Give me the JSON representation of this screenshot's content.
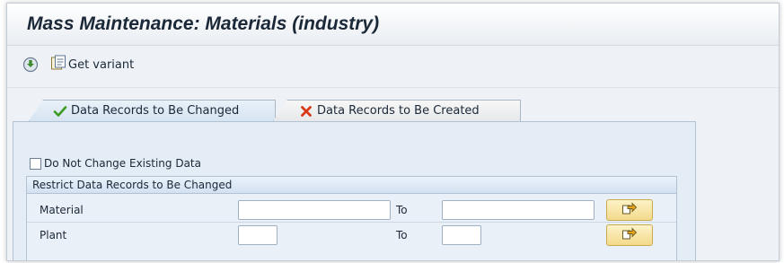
{
  "window": {
    "title": "Mass Maintenance: Materials (industry)"
  },
  "toolbar": {
    "execute_icon": "execute-icon",
    "get_variant_icon": "get-variant-icon",
    "get_variant_label": "Get variant"
  },
  "tabs": [
    {
      "label": "Data Records to Be Changed",
      "icon": "green-checkmark-icon",
      "active": true
    },
    {
      "label": "Data Records to Be Created",
      "icon": "red-x-icon",
      "active": false
    }
  ],
  "options": {
    "do_not_change_label": "Do Not Change Existing Data",
    "do_not_change_checked": false
  },
  "restrict_group": {
    "title": "Restrict Data Records to Be Changed",
    "rows": [
      {
        "label": "Material",
        "from_value": "",
        "to_label": "To",
        "to_value": "",
        "button_icon": "multiple-selection-arrow-icon"
      },
      {
        "label": "Plant",
        "from_value": "",
        "to_label": "To",
        "to_value": "",
        "button_icon": "multiple-selection-arrow-icon"
      }
    ]
  },
  "colors": {
    "background": "#eef2f6",
    "active_tab": "#d6e3f1",
    "check_green": "#3a9a1f",
    "cross_red": "#d93a1a",
    "multi_button": "#f3d98a"
  }
}
